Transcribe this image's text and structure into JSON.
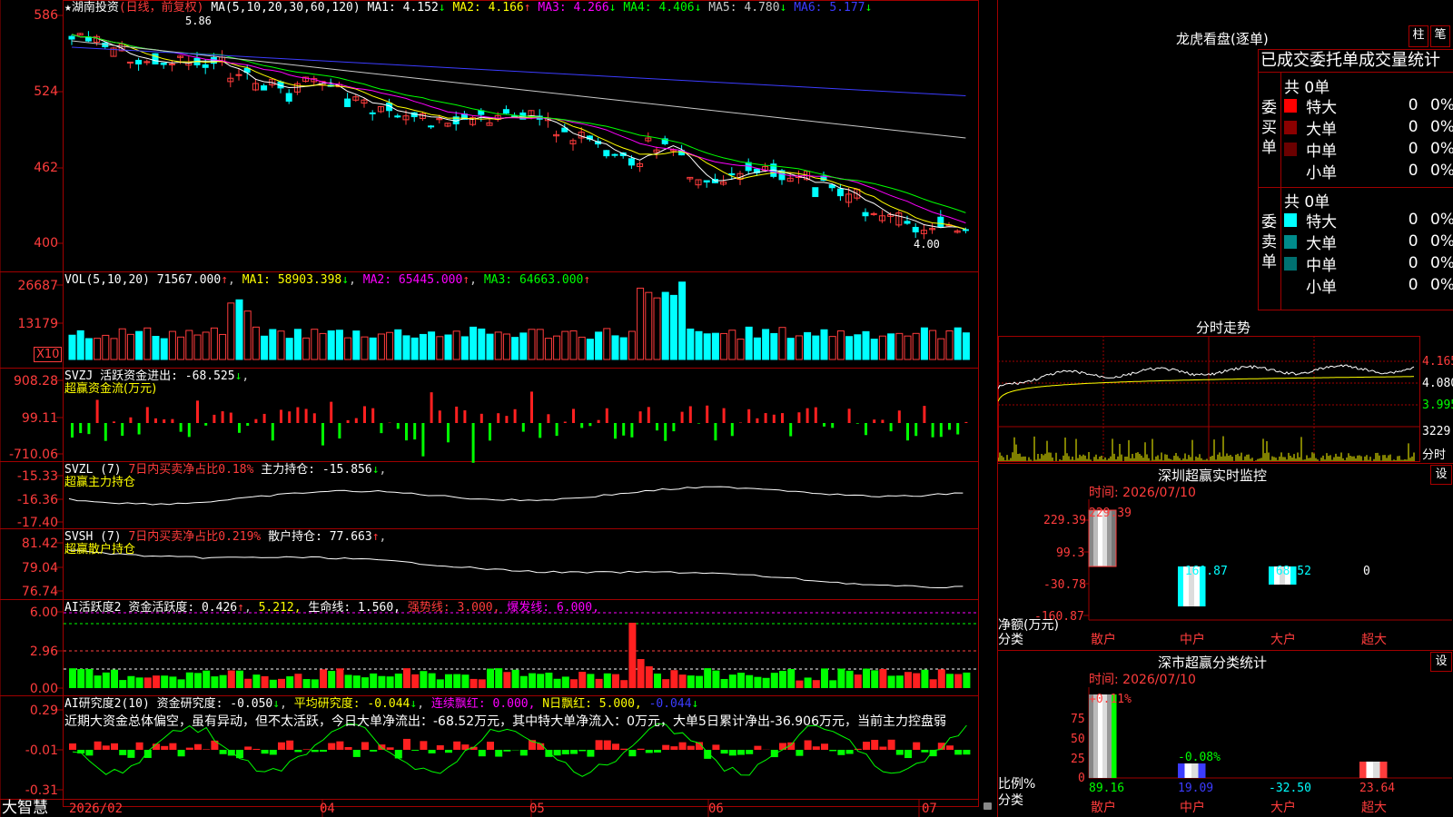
{
  "stock": {
    "name": "★湖南投资",
    "period": "(日线，前复权)",
    "ma_label": "MA(5,10,20,30,60,120)",
    "ma": [
      {
        "label": "MA1:",
        "value": "4.152",
        "arrow": "↓",
        "color": "#ffffff"
      },
      {
        "label": "MA2:",
        "value": "4.166",
        "arrow": "↑",
        "color": "#ffff00"
      },
      {
        "label": "MA3:",
        "value": "4.266",
        "arrow": "↓",
        "color": "#ff00ff"
      },
      {
        "label": "MA4:",
        "value": "4.406",
        "arrow": "↓",
        "color": "#00ff00"
      },
      {
        "label": "MA5:",
        "value": "4.780",
        "arrow": "↓",
        "color": "#c8c8c8"
      },
      {
        "label": "MA6:",
        "value": "5.177",
        "arrow": "↓",
        "color": "#3c3cff"
      }
    ],
    "high_mark": "5.86",
    "low_mark": "4.00",
    "axis": [
      "586",
      "524",
      "462",
      "400"
    ]
  },
  "vol": {
    "header": "VOL(5,10,20)",
    "value": "71567.000",
    "ma1": "MA1: 58903.398",
    "ma2": "MA2: 65445.000",
    "ma3": "MA3: 64663.000",
    "axis": [
      "26687",
      "13179"
    ],
    "unit": "X10"
  },
  "svzj": {
    "header": "SVZJ  活跃资金进出:",
    "value": "-68.525",
    "sub": "超赢资金流(万元)",
    "axis": [
      "908.28",
      "99.11",
      "-710.06"
    ]
  },
  "svzl": {
    "header": "SVZL (7)",
    "ratio": "7日内买卖净占比0.18%",
    "label": "主力持仓:",
    "value": "-15.856",
    "sub": "超赢主力持仓",
    "axis": [
      "-15.33",
      "-16.36",
      "-17.40"
    ]
  },
  "svsh": {
    "header": "SVSH (7)",
    "ratio": "7日内买卖净占比0.219%",
    "label": "散户持仓:",
    "value": "77.663",
    "sub": "超赢散户持仓",
    "axis": [
      "81.42",
      "79.04",
      "76.74"
    ]
  },
  "ai1": {
    "header": "AI活跃度2",
    "label": "资金活跃度:",
    "value": "0.426",
    "v2": "5.212,",
    "life": "生命线: 1.560,",
    "strong": "强势线: 3.000,",
    "burst": "爆发线: 6.000,",
    "axis": [
      "6.00",
      "2.96",
      "0.00"
    ]
  },
  "ai2": {
    "header": "AI研究度2(10)",
    "label": "资金研究度:",
    "value": "-0.050",
    "avg": "平均研究度: -0.044",
    "red": "连续飘红: 0.000,",
    "nred": "N日飘红: 5.000,",
    "last": "-0.044",
    "commentary": "近期大资金总体偏空，虽有异动，但不太活跃，今日大单净流出：-68.52万元，其中特大单净流入：0万元，大单5日累计净出-36.906万元，当前主力控盘弱",
    "axis": [
      "0.29",
      "-0.01",
      "-0.31"
    ]
  },
  "timeline": {
    "brand": "大智慧",
    "dates": [
      "2026/02",
      "04",
      "05",
      "06",
      "07"
    ]
  },
  "right": {
    "lhb_title": "龙虎看盘(逐单)",
    "btn_zhu": "柱",
    "btn_bi": "笔",
    "tabs": "已成交委托单成交量统计",
    "buy_label": "委买单",
    "sell_label": "委卖单",
    "buy_total": "共 0单",
    "sell_total": "共 0单",
    "buy_rows": [
      {
        "name": "特大",
        "count": "0",
        "pct": "0%",
        "color": "#ff0000"
      },
      {
        "name": "大单",
        "count": "0",
        "pct": "0%",
        "color": "#8b0000"
      },
      {
        "name": "中单",
        "count": "0",
        "pct": "0%",
        "color": "#6b0000"
      },
      {
        "name": "小单",
        "count": "0",
        "pct": "0%",
        "color": ""
      }
    ],
    "sell_rows": [
      {
        "name": "特大",
        "count": "0",
        "pct": "0%",
        "color": "#00ffff"
      },
      {
        "name": "大单",
        "count": "0",
        "pct": "0%",
        "color": "#008b8b"
      },
      {
        "name": "中单",
        "count": "0",
        "pct": "0%",
        "color": "#007070"
      },
      {
        "name": "小单",
        "count": "0",
        "pct": "0%",
        "color": ""
      }
    ],
    "fs_title": "分时走势",
    "fs_axis": [
      "4.165",
      "4.080",
      "3.995"
    ],
    "fs_vol": "3229",
    "fs_unit": "分时",
    "sz_title": "深圳超赢实时监控",
    "set_label": "设",
    "sz_time": "时间: 2026/07/10",
    "sz_axis": [
      "229.39",
      "99.3",
      "-30.78",
      "-160.87"
    ],
    "sz_vals": [
      "229.39",
      "-160.87",
      "-68.52",
      "0"
    ],
    "sz_unit1": "净额(万元)",
    "sz_unit2": "分类",
    "cats": [
      "散户",
      "中户",
      "大户",
      "超大"
    ],
    "fl_title": "深市超赢分类统计",
    "fl_time": "时间: 2026/07/10",
    "fl_axis": [
      "75",
      "50",
      "25",
      "0"
    ],
    "fl_top": [
      "+0.11%",
      "-0.08%"
    ],
    "fl_vals": [
      "89.16",
      "19.09",
      "-32.50",
      "23.64"
    ],
    "fl_unit1": "比例%",
    "fl_unit2": "分类"
  }
}
